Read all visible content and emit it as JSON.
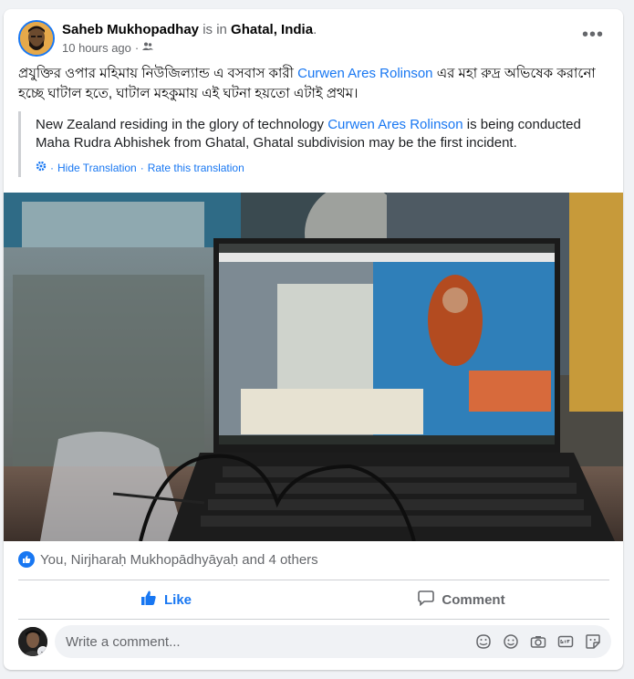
{
  "post": {
    "author": "Saheb Mukhopadhay",
    "is_in": " is in ",
    "location": "Ghatal, India",
    "period": ".",
    "time": "10 hours ago",
    "dot": "·",
    "text_part1": "প্রযুক্তির ওপার মহিমায় নিউজিল্যান্ড এ বসবাস কারী ",
    "text_link": "Curwen Ares Rolinson",
    "text_part2": " এর মহা রুদ্র অভিষেক করানো হচ্ছে ঘাটাল হতে, ঘাটাল মহকুমায় এই ঘটনা হয়তো এটাই প্রথম।",
    "translation_part1": "New Zealand residing in the glory of technology ",
    "translation_link": "Curwen Ares Rolinson",
    "translation_part2": " is being conducted Maha Rudra Abhishek from Ghatal, Ghatal subdivision may be the first incident.",
    "hide_translation": "Hide Translation",
    "rate_translation": "Rate this translation",
    "sep": "·"
  },
  "reactions": {
    "summary": "You, Nirjharaḥ Mukhopādhyāyaḥ and 4 others"
  },
  "actions": {
    "like": "Like",
    "comment": "Comment"
  },
  "comment_box": {
    "placeholder": "Write a comment..."
  },
  "colors": {
    "accent": "#1877f2",
    "muted": "#65676b",
    "divider": "#ced0d4"
  },
  "icons": [
    "more-options-icon",
    "friends-audience-icon",
    "gear-icon",
    "like-icon",
    "comment-icon",
    "avatar-sticker-icon",
    "emoji-icon",
    "camera-icon",
    "gif-icon",
    "sticker-icon"
  ]
}
